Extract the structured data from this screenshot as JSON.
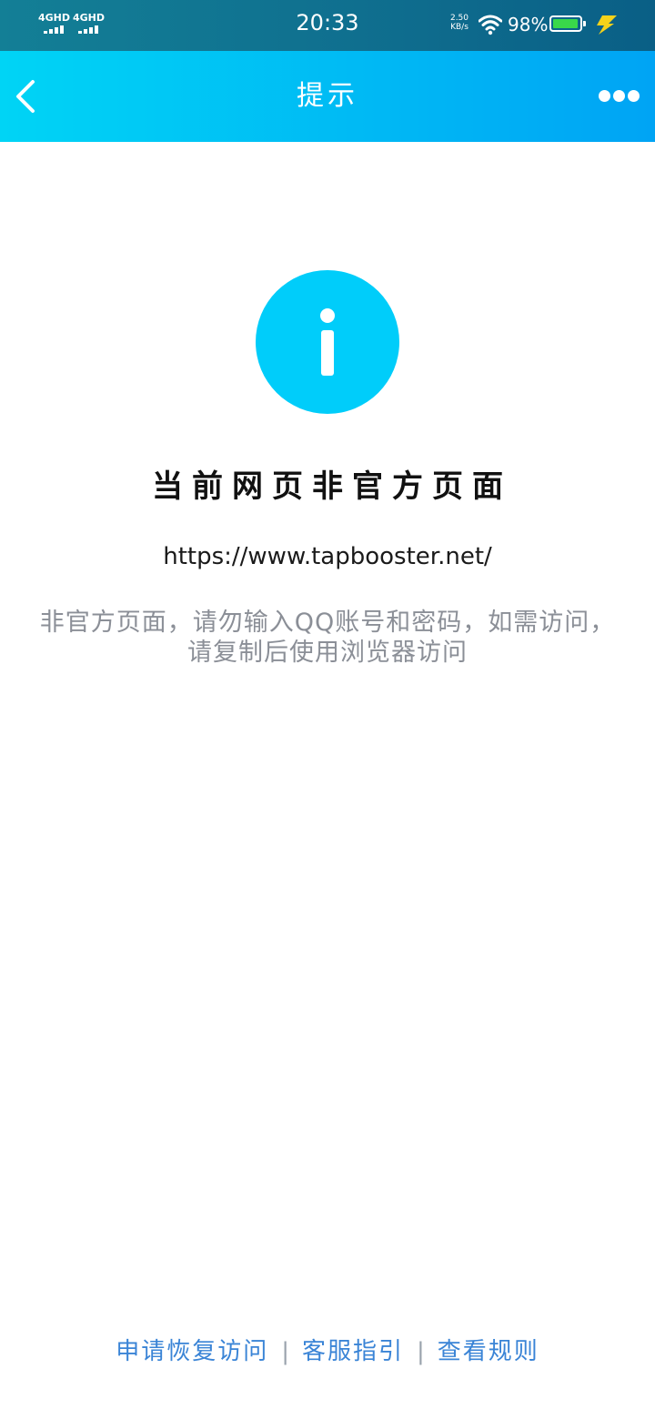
{
  "status_bar": {
    "sim1_label": "4GHD",
    "sim2_label": "4GHD",
    "time": "20:33",
    "net_speed_value": "2.50",
    "net_speed_unit": "KB/s",
    "battery_percent": "98%",
    "battery_level": 0.98,
    "battery_color": "#39d84a",
    "charging_bolt_color": "#f5d21a",
    "icons": [
      "signal-icon",
      "wifi-icon",
      "battery-icon",
      "charging-bolt-icon"
    ]
  },
  "nav": {
    "back_icon": "chevron-left-icon",
    "title": "提示",
    "more_icon": "more-dots-icon",
    "gradient": [
      "#00d4f5",
      "#00a4f4"
    ]
  },
  "content": {
    "info_icon": "info-icon",
    "info_color": "#00cdfa",
    "headline": "当前网页非官方页面",
    "url": "https://www.tapbooster.net/",
    "description": "非官方页面，请勿输入QQ账号和密码，如需访问，请复制后使用浏览器访问"
  },
  "footer": {
    "link_color": "#3a84d6",
    "links": [
      "申请恢复访问",
      "客服指引",
      "查看规则"
    ],
    "separator": "|"
  }
}
